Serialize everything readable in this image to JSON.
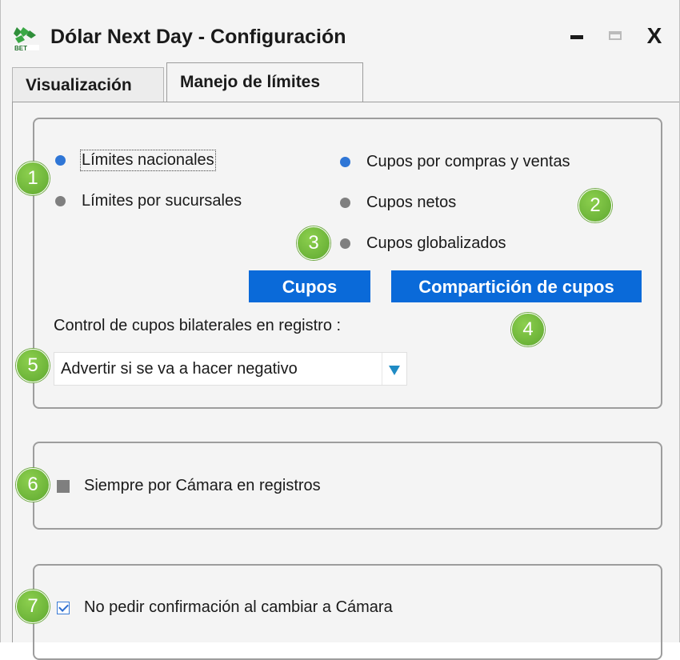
{
  "window": {
    "title": "Dólar Next Day - Configuración",
    "controls": {
      "minimize": "minimize",
      "maximize": "maximize",
      "close": "X"
    }
  },
  "tabs": [
    {
      "label": "Visualización",
      "active": false
    },
    {
      "label": "Manejo de límites",
      "active": true
    }
  ],
  "limits_group": {
    "options": [
      {
        "label": "Límites nacionales",
        "selected": true
      },
      {
        "label": "Límites por sucursales",
        "selected": false
      }
    ]
  },
  "cupos_group": {
    "options": [
      {
        "label": "Cupos por compras y ventas",
        "selected": true
      },
      {
        "label": "Cupos netos",
        "selected": false
      },
      {
        "label": "Cupos globalizados",
        "selected": false
      }
    ]
  },
  "buttons": {
    "cupos": "Cupos",
    "comparticion": "Compartición de cupos"
  },
  "bilateral_control": {
    "label": "Control de cupos bilaterales en registro :",
    "selected_value": "Advertir si se va a hacer negativo"
  },
  "camara_option": {
    "label": "Siempre por Cámara en registros",
    "checked": false
  },
  "confirm_option": {
    "label": "No pedir confirmación al cambiar a Cámara",
    "checked": true
  },
  "badges": [
    "1",
    "2",
    "3",
    "4",
    "5",
    "6",
    "7"
  ],
  "colors": {
    "accent": "#0a6ad9",
    "radio_on": "#2f76d6",
    "radio_off": "#7f7f7f",
    "badge": "#6ab23a"
  },
  "icons": {
    "app": "app-logo-icon",
    "dropdown": "triangle-down-icon"
  }
}
